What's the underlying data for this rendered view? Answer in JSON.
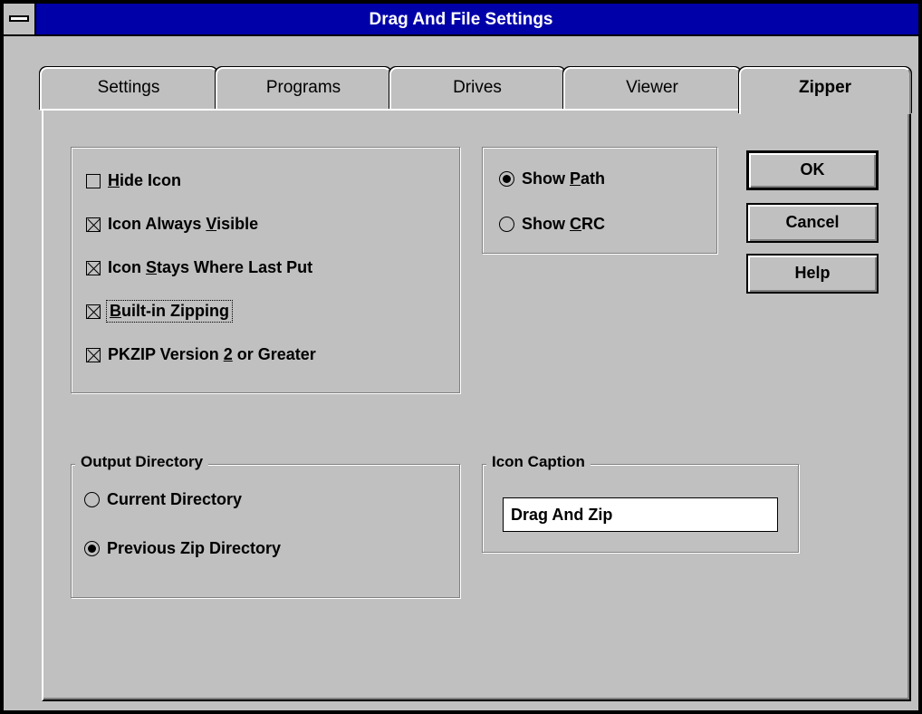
{
  "window": {
    "title": "Drag And File Settings"
  },
  "tabs": [
    {
      "label": "Settings",
      "active": false
    },
    {
      "label": "Programs",
      "active": false
    },
    {
      "label": "Drives",
      "active": false
    },
    {
      "label": "Viewer",
      "active": false
    },
    {
      "label": "Zipper",
      "active": true
    }
  ],
  "options": {
    "hide_icon": {
      "pre": "",
      "key": "H",
      "post": "ide Icon",
      "checked": false
    },
    "always_visible": {
      "pre": "Icon Always ",
      "key": "V",
      "post": "isible",
      "checked": true
    },
    "stays_put": {
      "pre": "Icon ",
      "key": "S",
      "post": "tays Where Last Put",
      "checked": true
    },
    "builtin_zip": {
      "pre": "",
      "key": "B",
      "post": "uilt-in Zipping",
      "checked": true,
      "focused": true
    },
    "pkzip_v2": {
      "pre": "PKZIP Version ",
      "key": "2",
      "post": " or Greater",
      "checked": true
    }
  },
  "display": {
    "show_path": {
      "pre": "Show ",
      "key": "P",
      "post": "ath",
      "selected": true
    },
    "show_crc": {
      "pre": "Show ",
      "key": "C",
      "post": "RC",
      "selected": false
    }
  },
  "buttons": {
    "ok": "OK",
    "cancel": "Cancel",
    "help": "Help"
  },
  "output_directory": {
    "label": "Output Directory",
    "current": {
      "label": "Current Directory",
      "selected": false
    },
    "previous": {
      "label": "Previous Zip Directory",
      "selected": true
    }
  },
  "icon_caption": {
    "label": "Icon Caption",
    "value": "Drag And Zip"
  }
}
